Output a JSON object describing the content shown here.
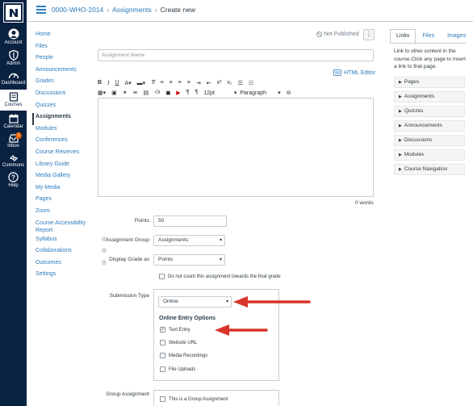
{
  "global_nav": {
    "items": [
      {
        "label": "Account",
        "icon": "account-icon"
      },
      {
        "label": "Admin",
        "icon": "admin-shield-icon"
      },
      {
        "label": "Dashboard",
        "icon": "dashboard-gauge-icon"
      },
      {
        "label": "Courses",
        "icon": "courses-book-icon"
      },
      {
        "label": "Calendar",
        "icon": "calendar-icon"
      },
      {
        "label": "Inbox",
        "icon": "inbox-icon",
        "badge": "1"
      },
      {
        "label": "Commons",
        "icon": "commons-icon"
      },
      {
        "label": "Help",
        "icon": "help-icon"
      }
    ]
  },
  "header": {
    "course": "0000-WHO-2014",
    "section": "Assignments",
    "current": "Create new"
  },
  "course_nav": {
    "items": [
      "Home",
      "Files",
      "People",
      "Announcements",
      "Grades",
      "Discussions",
      "Quizzes",
      "Assignments",
      "Modules",
      "Conferences",
      "Course Reserves",
      "Library Guide",
      "Media Gallery",
      "My Media",
      "Pages",
      "Zoom",
      "Course Accessibility Report",
      "Syllabus",
      "Collaborations",
      "Outcomes",
      "Settings"
    ]
  },
  "status": {
    "publish_label": "Not Published",
    "more": "⋮"
  },
  "form": {
    "name_placeholder": "Assignment Name",
    "html_editor_label": "HTML Editor",
    "toolbar": {
      "font_size": "12pt",
      "paragraph": "Paragraph"
    },
    "word_count": "0 words",
    "points_label": "Points",
    "points_value": "50",
    "group_label": "Assignment Group",
    "group_value": "Assignments",
    "display_label": "Display Grade as",
    "display_value": "Points",
    "no_count_label": "Do not count this assignment towards the final grade",
    "submission_label": "Submission Type",
    "submission_value": "Online",
    "entry_options_title": "Online Entry Options",
    "entry_options": [
      {
        "label": "Text Entry",
        "checked": true
      },
      {
        "label": "Website URL",
        "checked": false
      },
      {
        "label": "Media Recordings",
        "checked": false
      },
      {
        "label": "File Uploads",
        "checked": false
      }
    ],
    "group_assignment_label": "Group Assignment",
    "group_assignment_checkbox": "This is a Group Assignment"
  },
  "sidebar": {
    "tabs": [
      "Links",
      "Files",
      "Images"
    ],
    "description": "Link to other content in the course.Click any page to insert a link to that page.",
    "sections": [
      "Pages",
      "Assignments",
      "Quizzes",
      "Announcements",
      "Discussions",
      "Modules",
      "Course Navigation"
    ]
  },
  "colors": {
    "nav_bg": "#0a2242",
    "link": "#2b7abc",
    "annotation_arrow": "#d9342b",
    "badge": "#e66000"
  }
}
